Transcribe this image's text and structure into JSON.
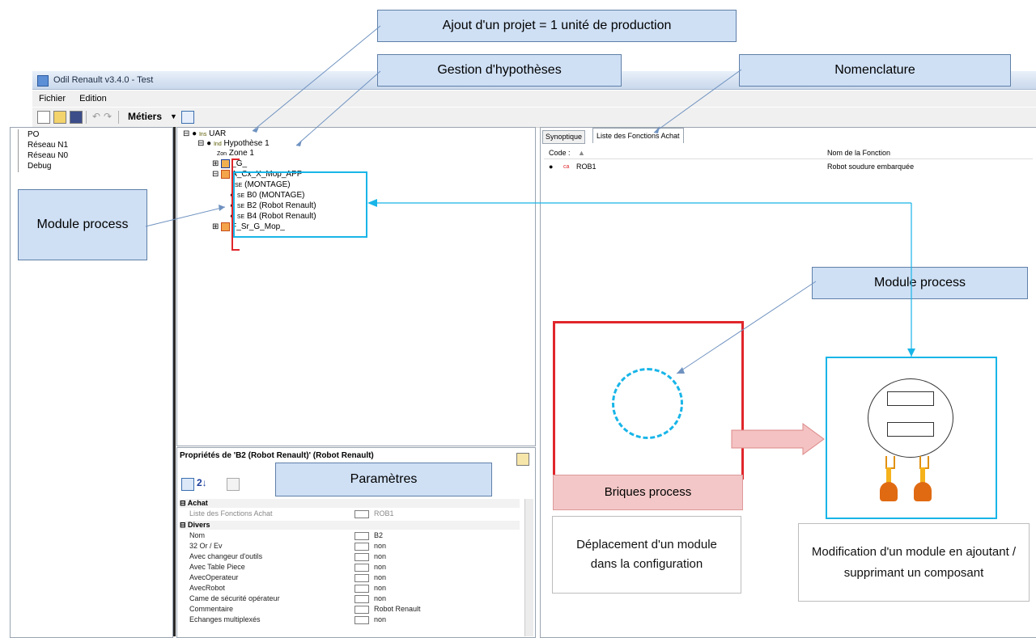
{
  "window": {
    "title": "Odil Renault v3.4.0 - Test"
  },
  "menu": {
    "items": [
      "Fichier",
      "Edition"
    ]
  },
  "toolbar": {
    "metiers_label": "Métiers"
  },
  "left_tree": [
    "PO",
    "Réseau N1",
    "Réseau N0",
    "Debug"
  ],
  "middle_tree": {
    "root": "UAR",
    "root_prefix": "Ins",
    "hypothesis": "Hypothèse 1",
    "hypothesis_prefix": "Ind",
    "zone_prefix": "Zon",
    "zone": "Zone 1",
    "items": [
      "_G_",
      "A_Cx_X_Mop_APP",
      "(MONTAGE)",
      "B0 (MONTAGE)",
      "B2 (Robot Renault)",
      "B4 (Robot Renault)",
      "F_Sr_G_Mop_"
    ],
    "se_prefix": "SE"
  },
  "properties": {
    "title": "Propriétés de 'B2 (Robot Renault)' (Robot Renault)",
    "group_achat": "Achat",
    "achat_rows": [
      {
        "key": "Liste des Fonctions Achat",
        "value": "ROB1"
      }
    ],
    "group_divers": "Divers",
    "divers_rows": [
      {
        "key": "Nom",
        "value": "B2"
      },
      {
        "key": "32 Or / Ev",
        "value": "non"
      },
      {
        "key": "Avec changeur d'outils",
        "value": "non"
      },
      {
        "key": "Avec Table Piece",
        "value": "non"
      },
      {
        "key": "AvecOperateur",
        "value": "non"
      },
      {
        "key": "AvecRobot",
        "value": "non"
      },
      {
        "key": "Came de sécurité opérateur",
        "value": "non"
      },
      {
        "key": "Commentaire",
        "value": "Robot Renault"
      },
      {
        "key": "Echanges multiplexés",
        "value": "non"
      }
    ]
  },
  "right_panel": {
    "tabs": [
      "Synoptique",
      "Liste des Fonctions Achat"
    ],
    "col_code": "Code :",
    "col_name": "Nom de la Fonction",
    "row_code": "ROB1",
    "row_name": "Robot soudure embarquée"
  },
  "annotations": {
    "ajout_projet": "Ajout d'un projet = 1 unité de production",
    "gestion_hypotheses": "Gestion d'hypothèses",
    "nomenclature": "Nomenclature",
    "module_process_left": "Module process",
    "module_process_right": "Module process",
    "parametres": "Paramètres",
    "briques_process": "Briques process",
    "deplacement": "Déplacement d'un module dans la configuration",
    "modification": "Modification d'un module en ajoutant / supprimant un composant"
  },
  "colors": {
    "cyan": "#18b5e8",
    "red": "#e0262b",
    "callout_bg": "#cfe0f5"
  }
}
